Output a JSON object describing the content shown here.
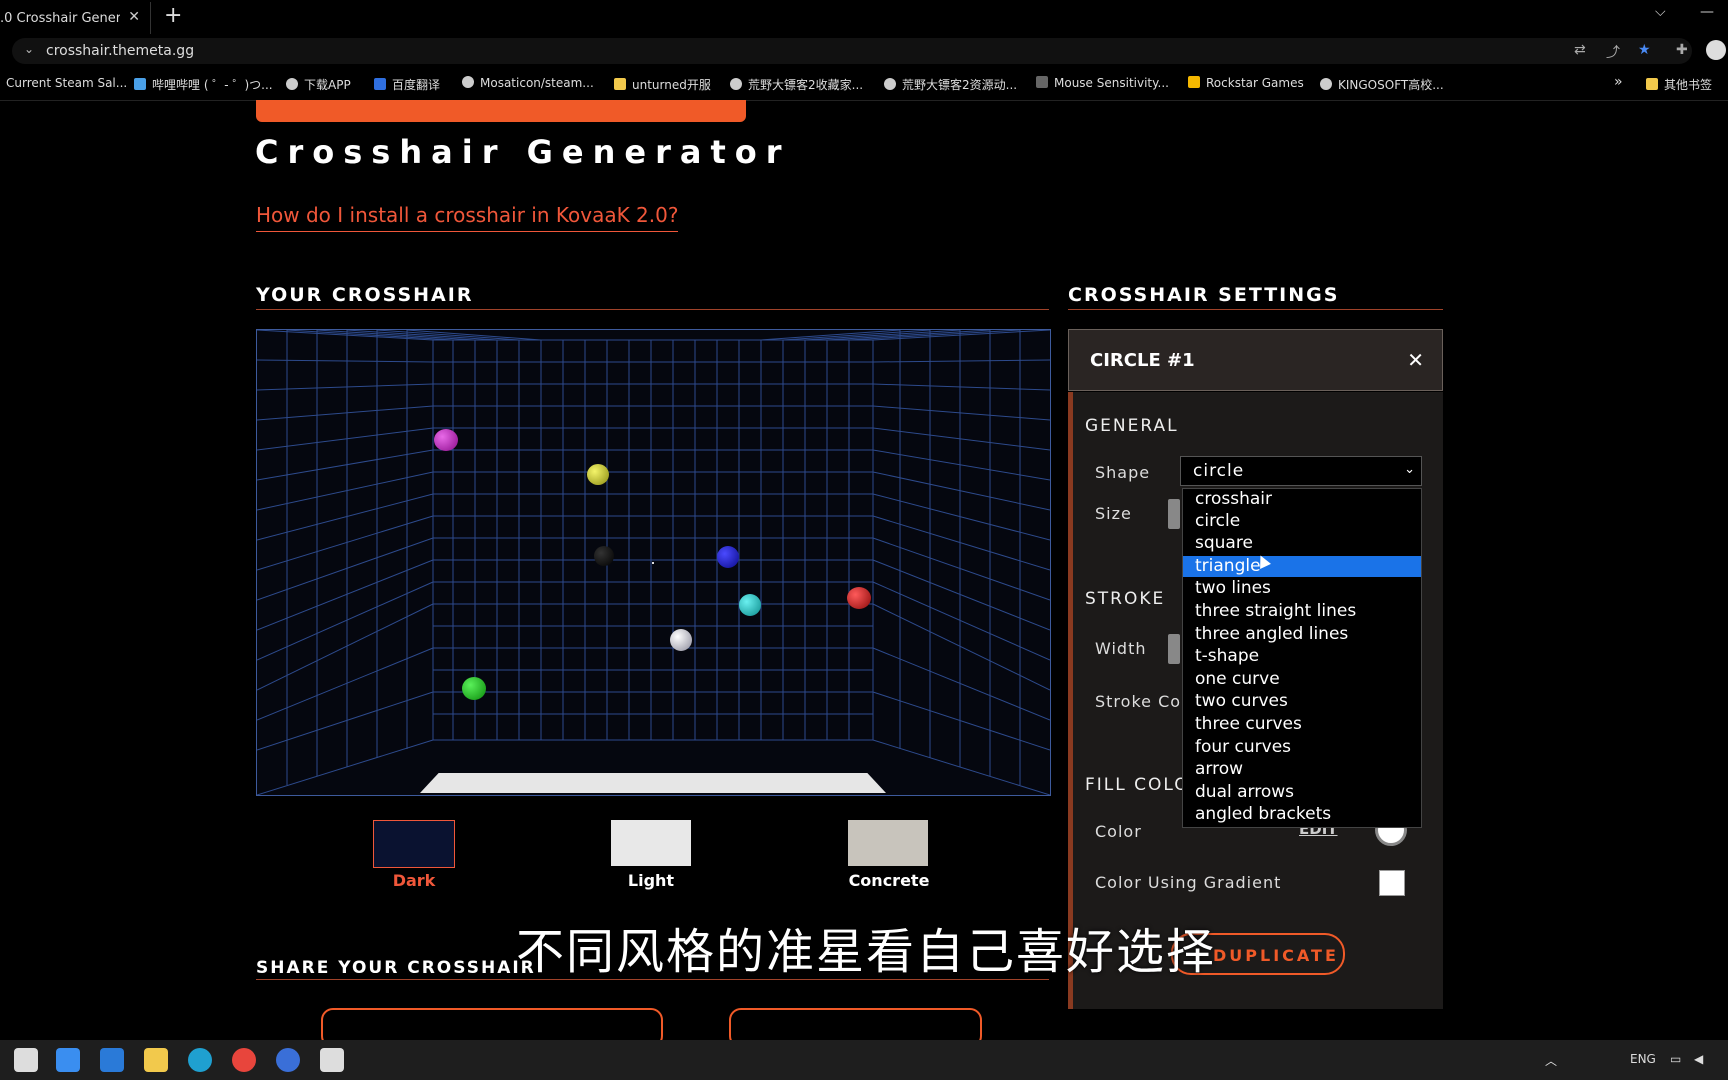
{
  "browser": {
    "tab_title": ".0 Crosshair Generator",
    "tab_close": "✕",
    "new_tab": "+",
    "url": "crosshair.themeta.gg",
    "bookmarks": [
      "Current Steam Sal...",
      "哔哩哔哩 ( ゜- ゜)つ...",
      "下载APP",
      "百度翻译",
      "Mosaticon/steam...",
      "unturned开服",
      "荒野大镖客2收藏家...",
      "荒野大镖客2资源动...",
      "Mouse Sensitivity...",
      "Rockstar Games",
      "KINGOSOFT高校...",
      "其他书签"
    ],
    "bookmarks_more": "»"
  },
  "page": {
    "subtitle": "Crosshair Generator",
    "install_link": "How do I install a crosshair in KovaaK 2.0?",
    "your_crosshair_heading": "YOUR CROSSHAIR",
    "settings_heading": "CROSSHAIR SETTINGS",
    "share_heading": "SHARE YOUR CROSSHAIR",
    "backgrounds": [
      "Dark",
      "Light",
      "Concrete"
    ],
    "subtitle_overlay": "不同风格的准星看自己喜好选择"
  },
  "settings": {
    "panel_title": "CIRCLE #1",
    "close": "✕",
    "general": "GENERAL",
    "shape_label": "Shape",
    "shape_value": "circle",
    "size_label": "Size",
    "stroke": "STROKE",
    "width_label": "Width",
    "stroke_color_label": "Stroke Co",
    "fill_color": "FILL COLO",
    "color_label": "Color",
    "edit": "EDIT",
    "gradient_label": "Color Using Gradient",
    "duplicate": "DUPLICATE",
    "shape_options": [
      "crosshair",
      "circle",
      "square",
      "triangle",
      "two lines",
      "three straight lines",
      "three angled lines",
      "t-shape",
      "one curve",
      "two curves",
      "three curves",
      "four curves",
      "arrow",
      "dual arrows",
      "angled brackets"
    ],
    "selected_option": "triangle"
  },
  "taskbar": {
    "lang": "ENG"
  },
  "colors": {
    "accent": "#f05a28",
    "link": "#f0573a",
    "selection": "#1a73e8",
    "grid": "#3d5a9c"
  }
}
